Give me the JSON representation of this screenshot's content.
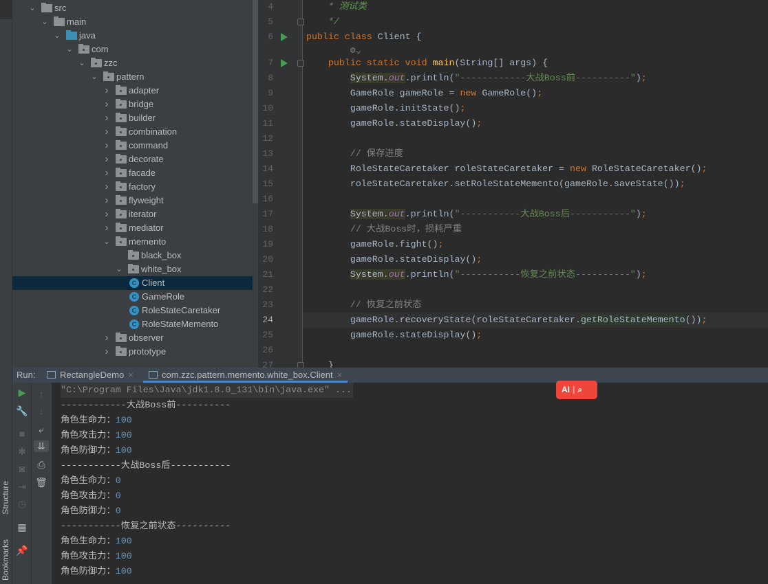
{
  "left_strip": {
    "tabs": [
      "Structure",
      "Bookmarks"
    ]
  },
  "tree": [
    {
      "label": "src",
      "depth": 0,
      "open": true,
      "icon": "folder"
    },
    {
      "label": "main",
      "depth": 1,
      "open": true,
      "icon": "folder"
    },
    {
      "label": "java",
      "depth": 2,
      "open": true,
      "icon": "source-folder"
    },
    {
      "label": "com",
      "depth": 3,
      "open": true,
      "icon": "package"
    },
    {
      "label": "zzc",
      "depth": 4,
      "open": true,
      "icon": "package"
    },
    {
      "label": "pattern",
      "depth": 5,
      "open": true,
      "icon": "package"
    },
    {
      "label": "adapter",
      "depth": 6,
      "open": false,
      "icon": "package"
    },
    {
      "label": "bridge",
      "depth": 6,
      "open": false,
      "icon": "package"
    },
    {
      "label": "builder",
      "depth": 6,
      "open": false,
      "icon": "package"
    },
    {
      "label": "combination",
      "depth": 6,
      "open": false,
      "icon": "package"
    },
    {
      "label": "command",
      "depth": 6,
      "open": false,
      "icon": "package"
    },
    {
      "label": "decorate",
      "depth": 6,
      "open": false,
      "icon": "package"
    },
    {
      "label": "facade",
      "depth": 6,
      "open": false,
      "icon": "package"
    },
    {
      "label": "factory",
      "depth": 6,
      "open": false,
      "icon": "package"
    },
    {
      "label": "flyweight",
      "depth": 6,
      "open": false,
      "icon": "package"
    },
    {
      "label": "iterator",
      "depth": 6,
      "open": false,
      "icon": "package"
    },
    {
      "label": "mediator",
      "depth": 6,
      "open": false,
      "icon": "package"
    },
    {
      "label": "memento",
      "depth": 6,
      "open": true,
      "icon": "package"
    },
    {
      "label": "black_box",
      "depth": 7,
      "open": null,
      "icon": "package"
    },
    {
      "label": "white_box",
      "depth": 7,
      "open": true,
      "icon": "package"
    },
    {
      "label": "Client",
      "depth": 8,
      "open": null,
      "icon": "class",
      "selected": true
    },
    {
      "label": "GameRole",
      "depth": 8,
      "open": null,
      "icon": "class"
    },
    {
      "label": "RoleStateCaretaker",
      "depth": 8,
      "open": null,
      "icon": "class"
    },
    {
      "label": "RoleStateMemento",
      "depth": 8,
      "open": null,
      "icon": "class"
    },
    {
      "label": "observer",
      "depth": 6,
      "open": false,
      "icon": "package"
    },
    {
      "label": "prototype",
      "depth": 6,
      "open": false,
      "icon": "package"
    }
  ],
  "editor": {
    "current_line": "24",
    "lines": [
      {
        "n": "4",
        "t": [
          [
            "    * 测试类",
            "dc"
          ]
        ]
      },
      {
        "n": "5",
        "t": [
          [
            "    */",
            "dc"
          ]
        ],
        "fold": true
      },
      {
        "n": "6",
        "run": true,
        "t": [
          [
            "public class ",
            "kw"
          ],
          [
            "Client {",
            ""
          ]
        ]
      },
      {
        "n": "",
        "inlay": true,
        "t": [
          [
            "        ⚙⌄",
            "cm"
          ]
        ]
      },
      {
        "n": "7",
        "run": true,
        "fold": true,
        "t": [
          [
            "    public static void ",
            "kw"
          ],
          [
            "main",
            "fn"
          ],
          [
            "(String[] args) {",
            ""
          ]
        ]
      },
      {
        "n": "8",
        "t": [
          [
            "        ",
            ""
          ],
          [
            "System.",
            "hl"
          ],
          [
            "out",
            "out hl"
          ],
          [
            ".println(",
            ""
          ],
          [
            "\"------------大战Boss前----------\"",
            "st"
          ],
          [
            ")",
            ""
          ],
          [
            ";",
            "kw"
          ]
        ]
      },
      {
        "n": "9",
        "t": [
          [
            "        GameRole gameRole = ",
            ""
          ],
          [
            "new ",
            "kw"
          ],
          [
            "GameRole()",
            ""
          ],
          [
            ";",
            "kw"
          ]
        ]
      },
      {
        "n": "10",
        "t": [
          [
            "        gameRole.initState()",
            ""
          ],
          [
            ";",
            "kw"
          ]
        ]
      },
      {
        "n": "11",
        "t": [
          [
            "        gameRole.stateDisplay()",
            ""
          ],
          [
            ";",
            "kw"
          ]
        ]
      },
      {
        "n": "12",
        "t": []
      },
      {
        "n": "13",
        "t": [
          [
            "        // 保存进度",
            "cm"
          ]
        ]
      },
      {
        "n": "14",
        "t": [
          [
            "        RoleStateCaretaker roleStateCaretaker = ",
            ""
          ],
          [
            "new ",
            "kw"
          ],
          [
            "RoleStateCaretaker()",
            ""
          ],
          [
            ";",
            "kw"
          ]
        ]
      },
      {
        "n": "15",
        "t": [
          [
            "        roleStateCaretaker.setRoleStateMemento(gameRole.saveState())",
            ""
          ],
          [
            ";",
            "kw"
          ]
        ]
      },
      {
        "n": "16",
        "t": []
      },
      {
        "n": "17",
        "t": [
          [
            "        ",
            ""
          ],
          [
            "System.",
            "hl"
          ],
          [
            "out",
            "out hl"
          ],
          [
            ".println(",
            ""
          ],
          [
            "\"-----------大战Boss后-----------\"",
            "st"
          ],
          [
            ")",
            ""
          ],
          [
            ";",
            "kw"
          ]
        ]
      },
      {
        "n": "18",
        "t": [
          [
            "        // 大战Boss时，损耗严重",
            "cm"
          ]
        ]
      },
      {
        "n": "19",
        "t": [
          [
            "        gameRole.fight()",
            ""
          ],
          [
            ";",
            "kw"
          ]
        ]
      },
      {
        "n": "20",
        "t": [
          [
            "        gameRole.stateDisplay()",
            ""
          ],
          [
            ";",
            "kw"
          ]
        ]
      },
      {
        "n": "21",
        "t": [
          [
            "        ",
            ""
          ],
          [
            "System.",
            "hl"
          ],
          [
            "out",
            "out hl"
          ],
          [
            ".println(",
            ""
          ],
          [
            "\"-----------恢复之前状态----------\"",
            "st"
          ],
          [
            ")",
            ""
          ],
          [
            ";",
            "kw"
          ]
        ]
      },
      {
        "n": "22",
        "t": []
      },
      {
        "n": "23",
        "t": [
          [
            "        // 恢复之前状态",
            "cm"
          ]
        ]
      },
      {
        "n": "24",
        "t": [
          [
            "        gameRole.recoveryState(roleStateCaretaker.",
            ""
          ],
          [
            "getRoleStateMemento",
            "hl2"
          ],
          [
            "())",
            ""
          ],
          [
            ";",
            "kw"
          ]
        ]
      },
      {
        "n": "25",
        "t": [
          [
            "        gameRole.stateDisplay()",
            ""
          ],
          [
            ";",
            "kw"
          ]
        ]
      },
      {
        "n": "26",
        "t": []
      },
      {
        "n": "27",
        "t": [
          [
            "    }",
            ""
          ]
        ],
        "fold": true
      }
    ]
  },
  "run": {
    "label": "Run:",
    "tabs": [
      {
        "label": "RectangleDemo",
        "active": false
      },
      {
        "label": "com.zzc.pattern.memento.white_box.Client",
        "active": true
      }
    ],
    "output": [
      {
        "text": "\"C:\\Program Files\\Java\\jdk1.8.0_131\\bin\\java.exe\" ...",
        "cmd": true
      },
      {
        "text": "------------大战Boss前----------"
      },
      {
        "text": "角色生命力：",
        "num": "100"
      },
      {
        "text": "角色攻击力：",
        "num": "100"
      },
      {
        "text": "角色防御力：",
        "num": "100"
      },
      {
        "text": "-----------大战Boss后-----------"
      },
      {
        "text": "角色生命力：",
        "num": "0"
      },
      {
        "text": "角色攻击力：",
        "num": "0"
      },
      {
        "text": "角色防御力：",
        "num": "0"
      },
      {
        "text": "-----------恢复之前状态----------"
      },
      {
        "text": "角色生命力：",
        "num": "100"
      },
      {
        "text": "角色攻击力：",
        "num": "100"
      },
      {
        "text": "角色防御力：",
        "num": "100"
      }
    ]
  },
  "ai_badge": {
    "label": "AI",
    "icon": "search-icon"
  }
}
